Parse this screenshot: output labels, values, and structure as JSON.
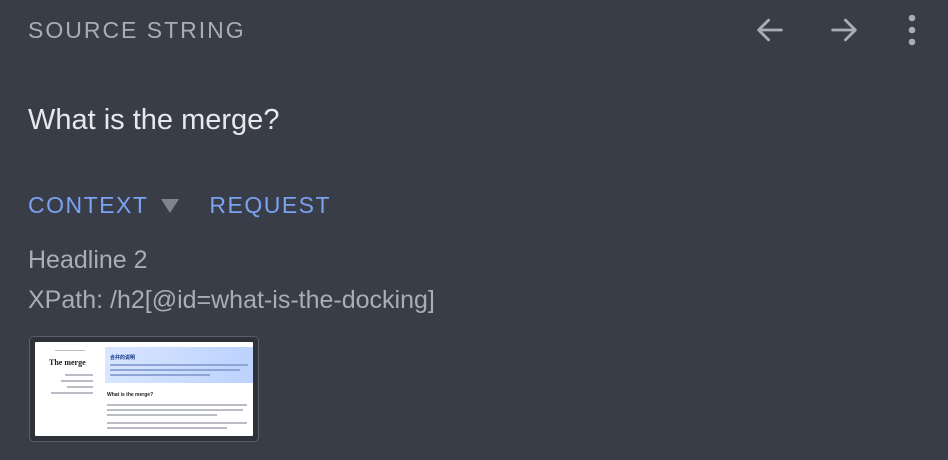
{
  "header": {
    "label": "SOURCE STRING",
    "back_icon": "arrow-left-icon",
    "forward_icon": "arrow-right-icon",
    "more_icon": "more-vert-icon"
  },
  "source": {
    "text": "What is the merge?"
  },
  "tabs": [
    {
      "label": "CONTEXT",
      "has_dropdown": true
    },
    {
      "label": "REQUEST",
      "has_dropdown": false
    }
  ],
  "context": {
    "element": "Headline 2",
    "xpath": "XPath: /h2[@id=what-is-the-docking]"
  },
  "screenshot_thumbnail": {
    "page_title": "The merge",
    "banner_title": "合并的说明",
    "section_heading": "What is the merge?"
  },
  "colors": {
    "background": "#393d48",
    "accent": "#7aa2f0",
    "muted_text": "#a9adb6",
    "primary_text": "#e6e8ec"
  }
}
